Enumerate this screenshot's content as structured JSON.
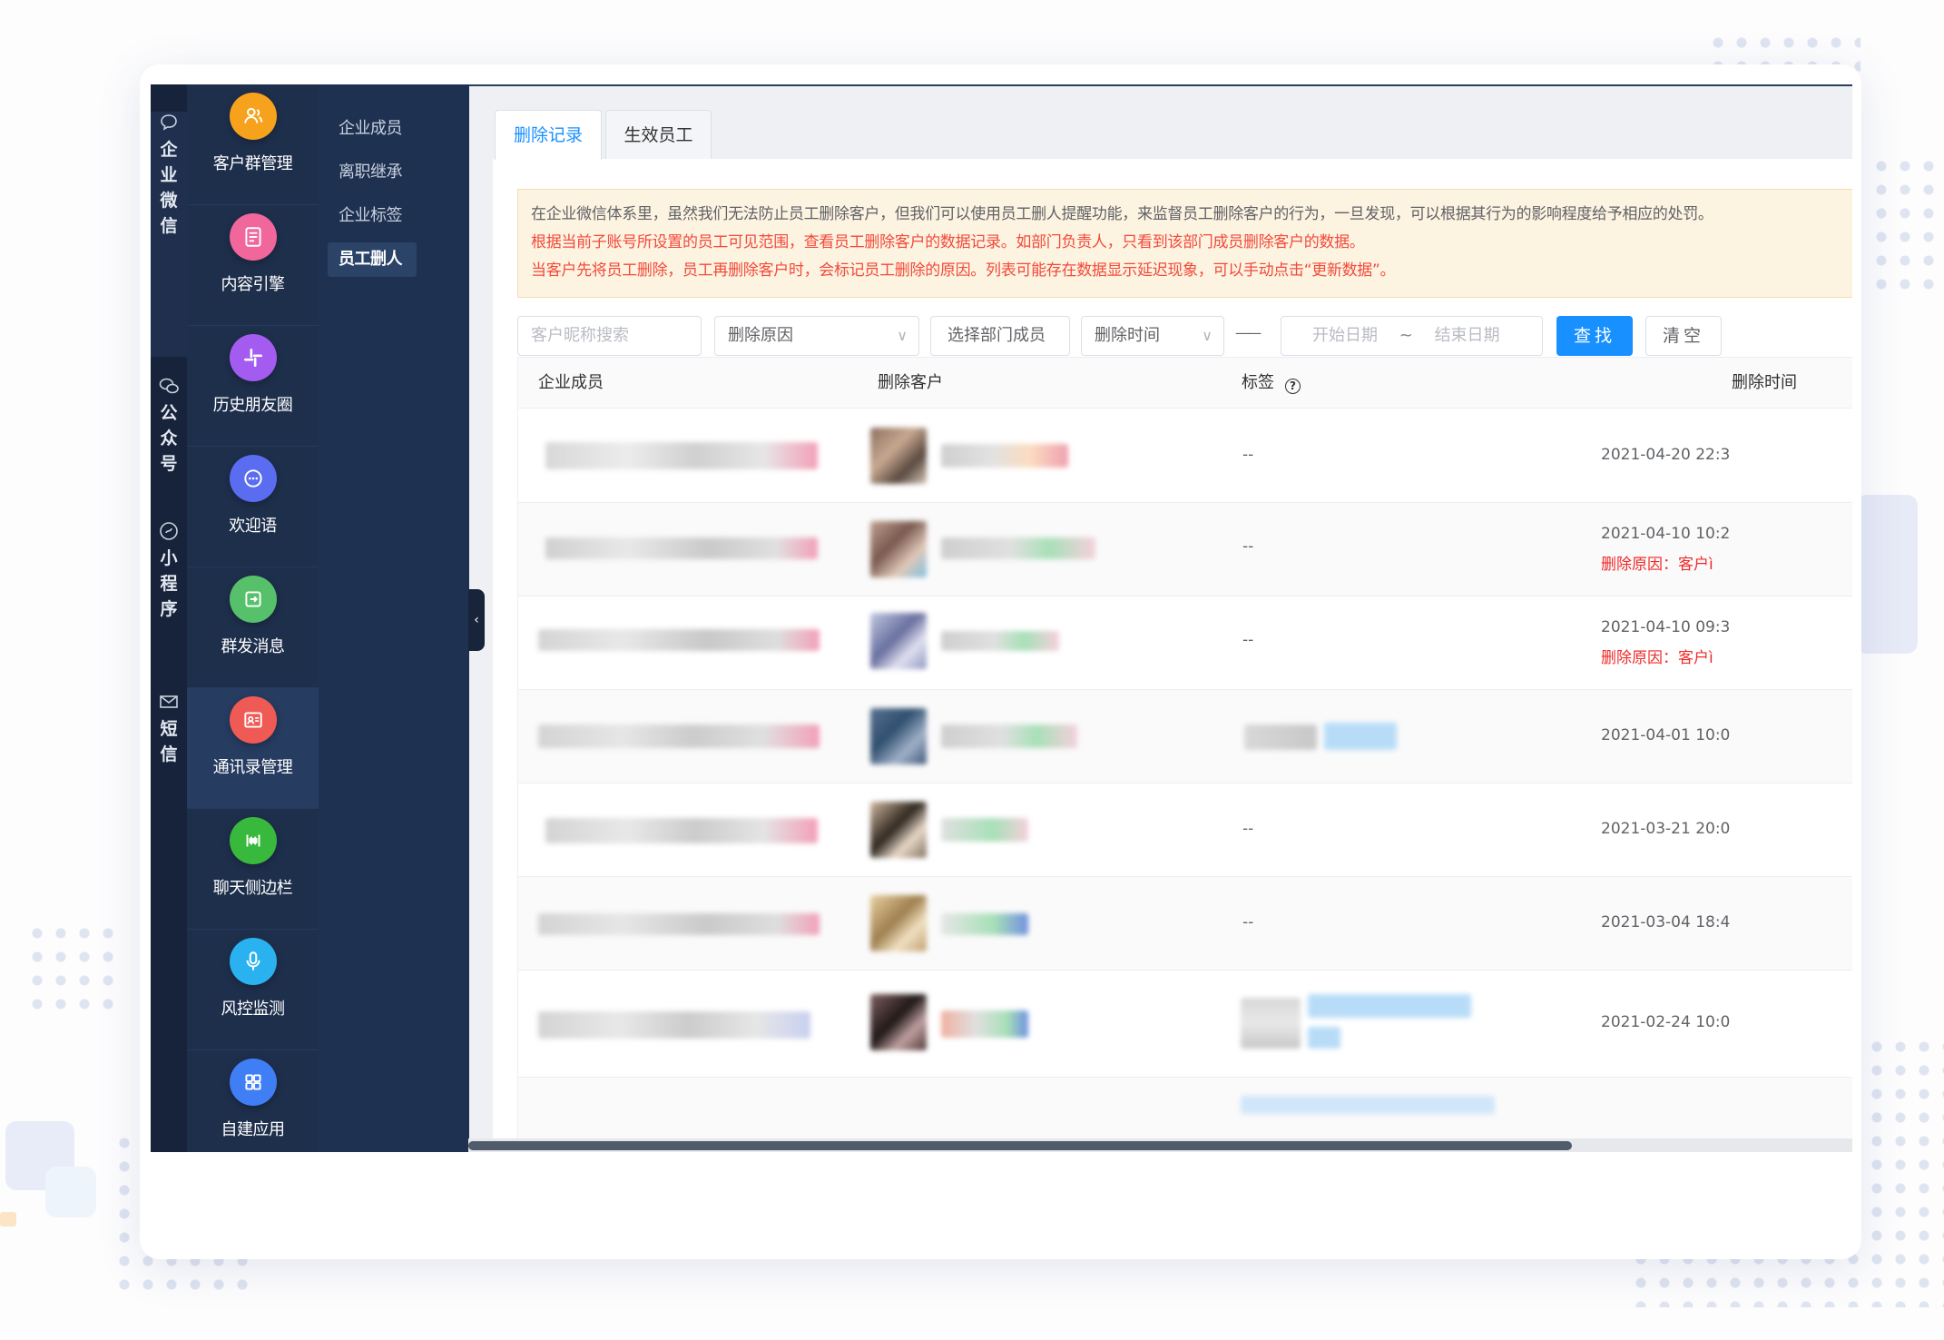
{
  "rail": [
    {
      "label": "企业微信",
      "icon": "chat-bubble-icon",
      "active": true
    },
    {
      "label": "公众号",
      "icon": "wechat-icon"
    },
    {
      "label": "小程序",
      "icon": "mini-program-icon"
    },
    {
      "label": "短信",
      "icon": "mail-icon"
    }
  ],
  "modules": [
    {
      "label": "客户群管理",
      "icon": "user-group-icon",
      "color": "#f7a21c"
    },
    {
      "label": "内容引擎",
      "icon": "content-icon",
      "color": "#f1679b"
    },
    {
      "label": "历史朋友圈",
      "icon": "moments-icon",
      "color": "#a45cf0"
    },
    {
      "label": "欢迎语",
      "icon": "welcome-icon",
      "color": "#5a6df0"
    },
    {
      "label": "群发消息",
      "icon": "broadcast-icon",
      "color": "#57c06a"
    },
    {
      "label": "通讯录管理",
      "icon": "contacts-icon",
      "color": "#f05a55",
      "active": true
    },
    {
      "label": "聊天侧边栏",
      "icon": "sidebar-icon",
      "color": "#38b83d"
    },
    {
      "label": "风控监测",
      "icon": "microphone-icon",
      "color": "#2ab2f0"
    },
    {
      "label": "自建应用",
      "icon": "grid-icon",
      "color": "#3f7ef5"
    }
  ],
  "submenu": [
    {
      "label": "企业成员"
    },
    {
      "label": "离职继承"
    },
    {
      "label": "企业标签"
    },
    {
      "label": "员工删人",
      "active": true
    }
  ],
  "tabs": [
    {
      "label": "删除记录",
      "active": true
    },
    {
      "label": "生效员工"
    }
  ],
  "notice": {
    "line1": "在企业微信体系里，虽然我们无法防止员工删除客户，但我们可以使用员工删人提醒功能，来监督员工删除客户的行为，一旦发现，可以根据其行为的影响程度给予相应的处罚。",
    "line2": "根据当前子账号所设置的员工可见范围，查看员工删除客户的数据记录。如部门负责人，只看到该部门成员删除客户的数据。",
    "line3": "当客户先将员工删除，员工再删除客户时，会标记员工删除的原因。列表可能存在数据显示延迟现象，可以手动点击“更新数据”。"
  },
  "filters": {
    "search_placeholder": "客户昵称搜索",
    "reason_placeholder": "删除原因",
    "dept_button": "选择部门成员",
    "time_placeholder": "删除时间",
    "range_separator": "——",
    "start_placeholder": "开始日期",
    "tilde": "~",
    "end_placeholder": "结束日期",
    "search_button": "查找",
    "clear_button": "清空"
  },
  "table": {
    "columns": [
      "企业成员",
      "删除客户",
      "标签",
      "删除时间"
    ],
    "rows": [
      {
        "tag": "--",
        "time": "2021-04-20 22:3",
        "reason": ""
      },
      {
        "tag": "--",
        "time": "2021-04-10 10:2",
        "reason": "删除原因：客户ì"
      },
      {
        "tag": "--",
        "time": "2021-04-10 09:3",
        "reason": "删除原因：客户ì"
      },
      {
        "tag": "",
        "time": "2021-04-01 10:0",
        "reason": ""
      },
      {
        "tag": "--",
        "time": "2021-03-21 20:0",
        "reason": ""
      },
      {
        "tag": "--",
        "time": "2021-03-04 18:4",
        "reason": ""
      },
      {
        "tag": "",
        "time": "2021-02-24 10:0",
        "reason": ""
      }
    ]
  },
  "colors": {
    "primary": "#1890ff",
    "warning_text": "#f24a3a",
    "nav_dark": "#16233a",
    "nav_mid": "#1e2f4c"
  }
}
